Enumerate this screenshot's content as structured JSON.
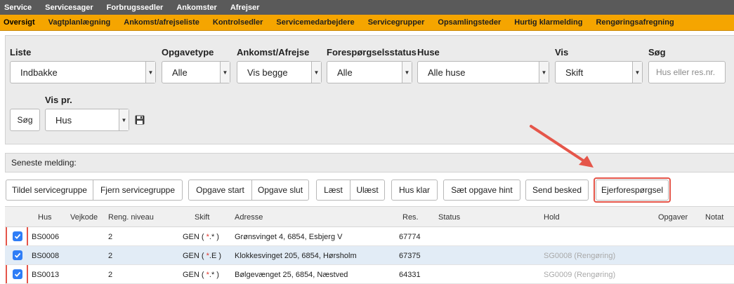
{
  "topnav": [
    "Service",
    "Servicesager",
    "Forbrugssedler",
    "Ankomster",
    "Afrejser"
  ],
  "subnav": [
    "Oversigt",
    "Vagtplanlægning",
    "Ankomst/afrejseliste",
    "Kontrolsedler",
    "Servicemedarbejdere",
    "Servicegrupper",
    "Opsamlingsteder",
    "Hurtig klarmelding",
    "Rengøringsafregning"
  ],
  "filters": {
    "liste": {
      "label": "Liste",
      "value": "Indbakke"
    },
    "opgavetype": {
      "label": "Opgavetype",
      "value": "Alle"
    },
    "ankomst": {
      "label": "Ankomst/Afrejse",
      "value": "Vis begge"
    },
    "status": {
      "label": "Forespørgselsstatus",
      "value": "Alle"
    },
    "huse": {
      "label": "Huse",
      "value": "Alle huse"
    },
    "vis": {
      "label": "Vis",
      "value": "Skift"
    },
    "sog": {
      "label": "Søg",
      "placeholder": "Hus eller res.nr."
    },
    "vis_pr": {
      "label": "Vis pr.",
      "value": "Hus"
    },
    "search_button": "Søg"
  },
  "message_label": "Seneste melding:",
  "actions": {
    "tildel": "Tildel servicegruppe",
    "fjern": "Fjern servicegruppe",
    "opgave_start": "Opgave start",
    "opgave_slut": "Opgave slut",
    "laest": "Læst",
    "ulaest": "Ulæst",
    "hus_klar": "Hus klar",
    "saet_hint": "Sæt opgave hint",
    "send_besked": "Send besked",
    "ejer": "Ejerforespørgsel"
  },
  "table": {
    "headers": {
      "hus": "Hus",
      "vejkode": "Vejkode",
      "reng": "Reng. niveau",
      "skift": "Skift",
      "adresse": "Adresse",
      "res": "Res.",
      "status": "Status",
      "hold": "Hold",
      "opgaver": "Opgaver",
      "notat": "Notat"
    },
    "rows": [
      {
        "hus": "BS0006",
        "reng": "2",
        "skift_pre": "GEN ( ",
        "skift_mark": "*",
        "skift_post": ".* )",
        "adresse": "Grønsvinget 4, 6854, Esbjerg V",
        "res": "67774",
        "hold": ""
      },
      {
        "hus": "BS0008",
        "reng": "2",
        "skift_pre": "GEN ( ",
        "skift_mark": "*",
        "skift_post": ".E )",
        "adresse": "Klokkesvinget 205, 6854, Hørsholm",
        "res": "67375",
        "hold": "SG0008 (Rengøring)"
      },
      {
        "hus": "BS0013",
        "reng": "2",
        "skift_pre": "GEN ( ",
        "skift_mark": "*",
        "skift_post": ".* )",
        "adresse": "Bølgevænget 25, 6854, Næstved",
        "res": "64331",
        "hold": "SG0009 (Rengøring)"
      }
    ]
  },
  "colors": {
    "accent_orange": "#f5a500",
    "annotation_red": "#e5564a",
    "checkbox_blue": "#2f7df6"
  }
}
